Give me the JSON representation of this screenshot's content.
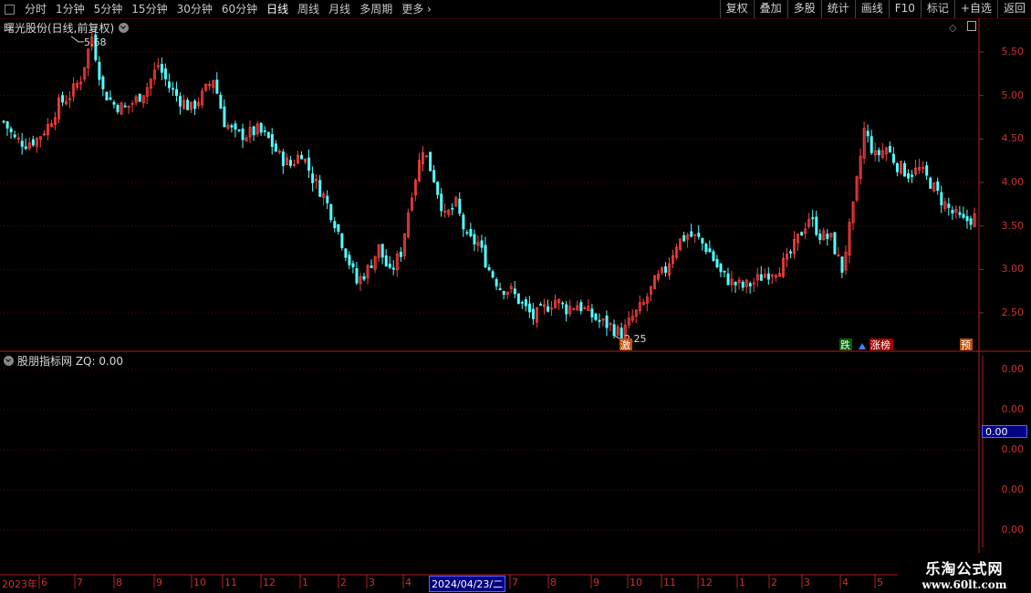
{
  "toolbar": {
    "tabs": [
      "分时",
      "1分钟",
      "5分钟",
      "15分钟",
      "30分钟",
      "60分钟",
      "日线",
      "周线",
      "月线",
      "多周期",
      "更多"
    ],
    "active_tab": "日线",
    "tools": [
      "复权",
      "叠加",
      "多股",
      "统计",
      "画线",
      "F10",
      "标记",
      "+自选",
      "返回"
    ]
  },
  "main_chart": {
    "title": "曙光股份(日线,前复权)",
    "y_axis_labels": [
      "5.50",
      "5.00",
      "4.50",
      "4.00",
      "3.50",
      "3.00",
      "2.50"
    ],
    "high_label": "5.68",
    "low_label": "2.25",
    "tags": {
      "surge": "激",
      "down": "跌",
      "limit_up": "涨榜",
      "forecast": "预"
    }
  },
  "indicator_panel": {
    "title": "股朋指标网 ZQ: 0.00",
    "y_axis_labels": [
      "0.00",
      "0.00",
      "0.00",
      "0.00",
      "0.00"
    ],
    "current_value": "0.00"
  },
  "date_axis": {
    "labels": [
      "2023年",
      "6",
      "7",
      "8",
      "9",
      "10",
      "11",
      "12",
      "1",
      "2",
      "3",
      "4",
      "7",
      "8",
      "9",
      "10",
      "11",
      "12",
      "1",
      "2",
      "3",
      "4",
      "5"
    ],
    "cursor_date": "2024/04/23/二"
  },
  "watermark": {
    "name": "乐淘公式网",
    "url": "www.60lt.com"
  },
  "colors": {
    "up": "#ff4040",
    "down": "#54ffff",
    "axis": "#c83232",
    "grid": "#600000",
    "bg": "#000000"
  },
  "chart_data": {
    "type": "candlestick",
    "title": "曙光股份(日线,前复权)",
    "ylim": [
      2.2,
      5.85
    ],
    "y_ticks": [
      2.5,
      3.0,
      3.5,
      4.0,
      4.5,
      5.0,
      5.5
    ],
    "x_ticks": [
      "2023年",
      "6",
      "7",
      "8",
      "9",
      "10",
      "11",
      "12",
      "1",
      "2",
      "3",
      "4",
      "2024/04/23/二",
      "7",
      "8",
      "9",
      "10",
      "11",
      "12",
      "1",
      "2",
      "3",
      "4",
      "5"
    ],
    "close_path": [
      4.7,
      4.5,
      4.45,
      4.5,
      4.65,
      4.9,
      5.0,
      5.2,
      5.68,
      5.05,
      4.9,
      4.85,
      4.95,
      5.1,
      5.35,
      5.1,
      4.95,
      4.85,
      5.0,
      5.2,
      4.7,
      4.55,
      4.55,
      4.6,
      4.5,
      4.3,
      4.2,
      4.35,
      4.05,
      3.85,
      3.55,
      3.2,
      2.85,
      3.0,
      3.25,
      2.95,
      3.2,
      3.9,
      4.4,
      4.05,
      3.6,
      3.75,
      3.35,
      3.3,
      3.0,
      2.8,
      2.75,
      2.6,
      2.45,
      2.55,
      2.65,
      2.55,
      2.6,
      2.5,
      2.4,
      2.35,
      2.25,
      2.45,
      2.6,
      2.85,
      3.0,
      3.3,
      3.4,
      3.35,
      3.2,
      2.95,
      2.85,
      2.8,
      2.85,
      2.95,
      3.0,
      3.1,
      3.35,
      3.6,
      3.4,
      3.35,
      3.0,
      3.7,
      4.6,
      4.3,
      4.4,
      4.2,
      4.1,
      4.15,
      4.0,
      3.8,
      3.65,
      3.55,
      3.6
    ],
    "markers": [
      {
        "label": "5.68",
        "value": 5.68
      },
      {
        "label": "2.25",
        "value": 2.25
      }
    ]
  }
}
